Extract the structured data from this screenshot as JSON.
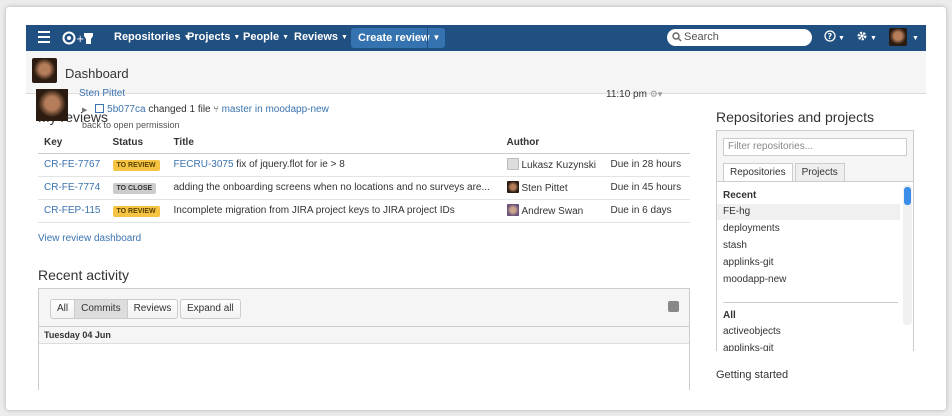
{
  "nav": {
    "items": [
      "Repositories",
      "Projects",
      "People",
      "Reviews"
    ],
    "create_review": "Create review",
    "search_placeholder": "Search"
  },
  "page": {
    "title": "Dashboard"
  },
  "reviews": {
    "heading": "My reviews",
    "columns": [
      "Key",
      "Status",
      "Title",
      "Author",
      ""
    ],
    "rows": [
      {
        "key": "CR-FE-7767",
        "status": "TO REVIEW",
        "title_link": "FECRU-3075",
        "title": " fix of jquery.flot for ie > 8",
        "author": "Lukasz Kuzynski",
        "due": "Due in 28 hours"
      },
      {
        "key": "CR-FE-7774",
        "status": "TO CLOSE",
        "title_link": "",
        "title": "adding the onboarding screens when no locations and no surveys are...",
        "author": "Sten Pittet",
        "due": "Due in 45 hours"
      },
      {
        "key": "CR-FEP-115",
        "status": "TO REVIEW",
        "title_link": "",
        "title": "Incomplete migration from JIRA project keys to JIRA project IDs",
        "author": "Andrew Swan",
        "due": "Due in 6 days"
      }
    ],
    "dashboard_link": "View review dashboard"
  },
  "activity": {
    "heading": "Recent activity",
    "filters": [
      "All",
      "Commits",
      "Reviews"
    ],
    "expand": "Expand all",
    "day": "Tuesday 04 Jun",
    "entry": {
      "user": "Sten Pittet",
      "commit": "5b077ca",
      "changed": " changed 1 file ",
      "branch": "master in moodapp-new",
      "time": "11:10 pm",
      "message": "back to open permission"
    }
  },
  "repos": {
    "heading": "Repositories and projects",
    "filter_placeholder": "Filter repositories...",
    "tabs": [
      "Repositories",
      "Projects"
    ],
    "recent_label": "Recent",
    "recent": [
      "FE-hg",
      "deployments",
      "stash",
      "applinks-git",
      "moodapp-new"
    ],
    "all_label": "All",
    "all": [
      "activeobjects",
      "applinks-git"
    ]
  },
  "getting_started": "Getting started"
}
